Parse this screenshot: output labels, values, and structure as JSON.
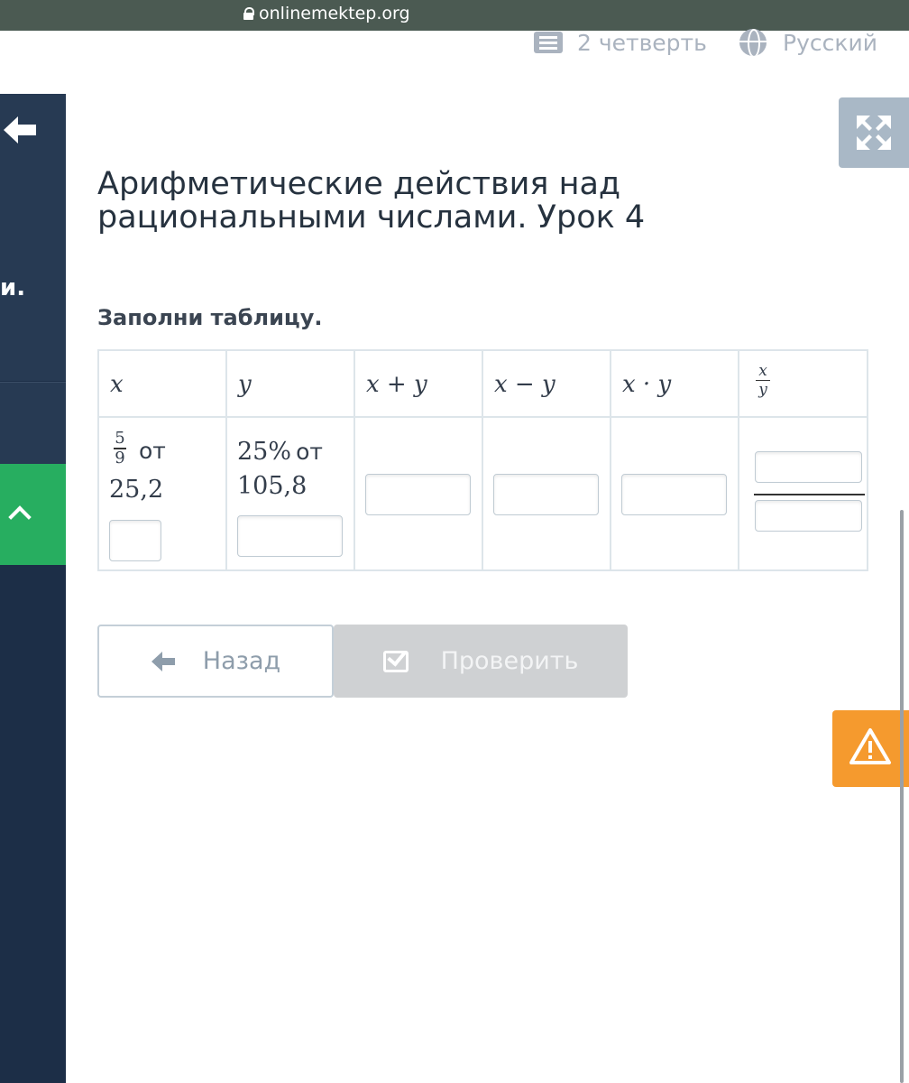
{
  "browser": {
    "url": "onlinemektep.org"
  },
  "topnav": {
    "quarter": "2 четверть",
    "language": "Русский"
  },
  "sidebar": {
    "truncated_text": "и."
  },
  "lesson": {
    "title": "Арифметические действия над рациональными числами. Урок 4",
    "task": "Заполни таблицу."
  },
  "table": {
    "headers": [
      "x",
      "y",
      "x + y",
      "x − y",
      "x · y"
    ],
    "last_header_fraction": {
      "numerator": "x",
      "denominator": "y"
    },
    "row": {
      "x": {
        "fraction_numerator": "5",
        "fraction_denominator": "9",
        "of_word": "от",
        "value": "25,2"
      },
      "y": {
        "percent": "25%",
        "of_word": "от",
        "value": "105,8"
      }
    },
    "inputs": {
      "x_answer": "",
      "y_answer": "",
      "sum": "",
      "difference": "",
      "product": "",
      "quotient_numerator": "",
      "quotient_denominator": ""
    }
  },
  "buttons": {
    "back": "Назад",
    "check": "Проверить"
  },
  "colors": {
    "sidebar": "#1c2e47",
    "green": "#27ae60",
    "orange": "#f59a2e",
    "disabled": "#cfd1d3"
  }
}
